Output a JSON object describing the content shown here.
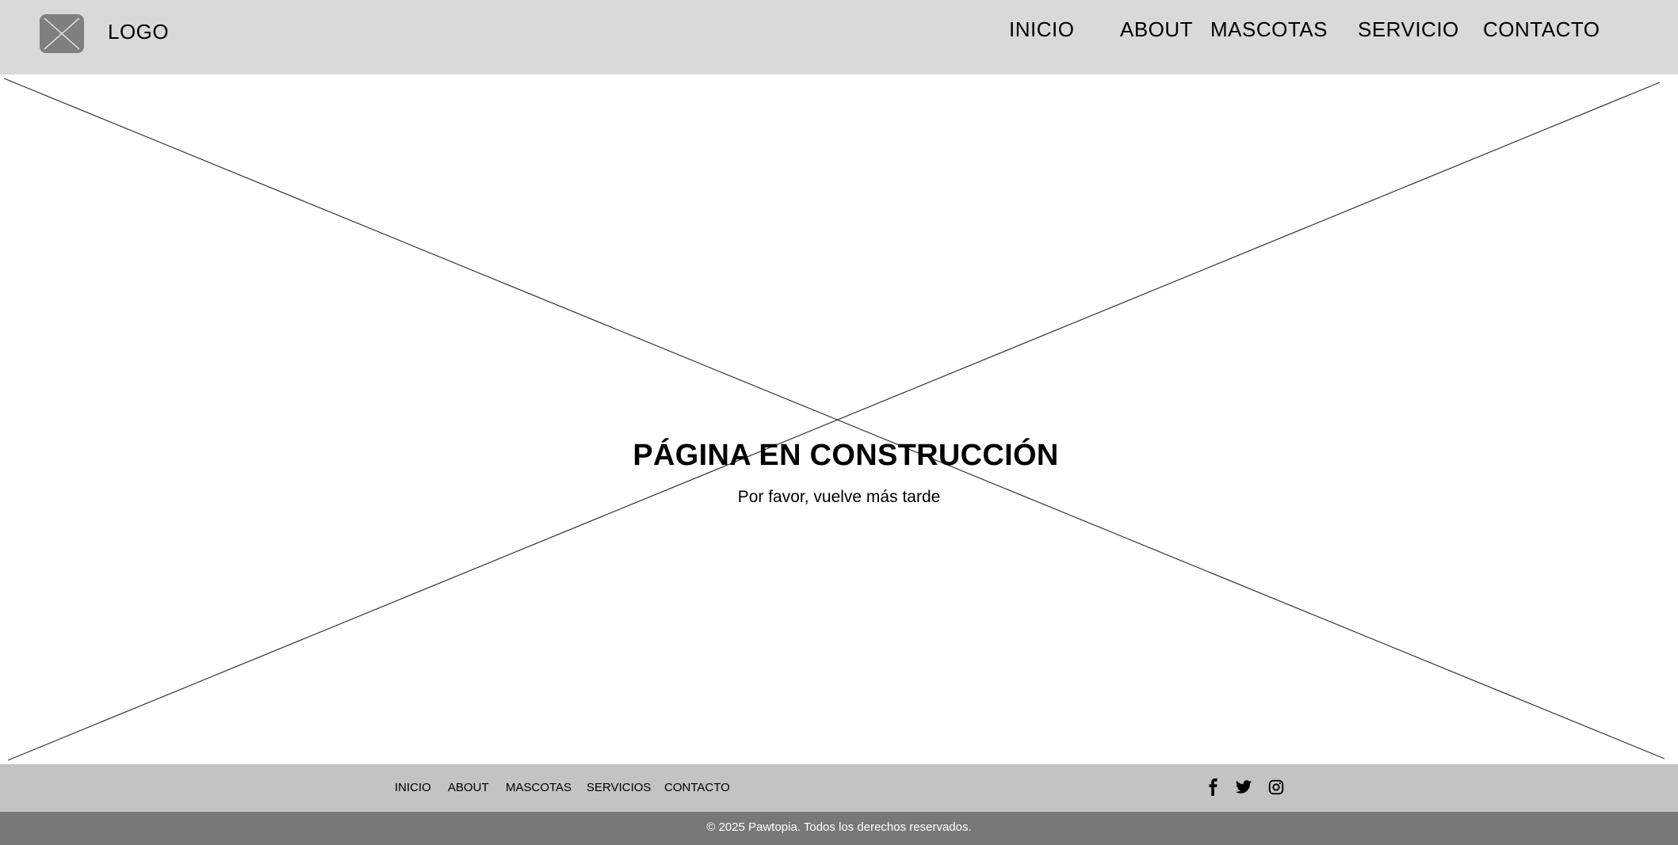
{
  "header": {
    "logo_text": "LOGO",
    "nav": [
      {
        "label": "INICIO"
      },
      {
        "label": "ABOUT"
      },
      {
        "label": "MASCOTAS"
      },
      {
        "label": "SERVICIO"
      },
      {
        "label": "CONTACTO"
      }
    ]
  },
  "main": {
    "title": "PÁGINA EN CONSTRUCCIÓN",
    "subtitle": "Por favor, vuelve más tarde"
  },
  "footer": {
    "links": [
      {
        "label": "INICIO"
      },
      {
        "label": "ABOUT"
      },
      {
        "label": "MASCOTAS"
      },
      {
        "label": "SERVICIOS"
      },
      {
        "label": "CONTACTO"
      }
    ],
    "social_icons": [
      "facebook-icon",
      "twitter-icon",
      "instagram-icon"
    ],
    "copyright": "© 2025 Pawtopia. Todos los derechos reservados."
  },
  "colors": {
    "header_bg": "#d9d9d9",
    "footer_nav_bg": "#c3c3c3",
    "footer_bottom_bg": "#787878",
    "logo_placeholder": "#7f7f7f"
  }
}
